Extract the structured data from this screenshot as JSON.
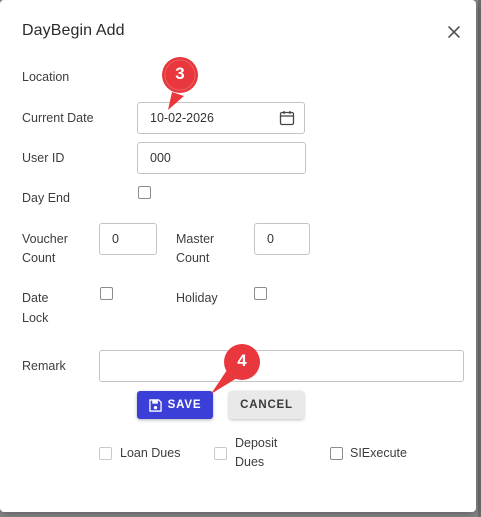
{
  "dialog": {
    "title": "DayBegin Add",
    "close_icon": "close-icon"
  },
  "form": {
    "location_label": "Location",
    "current_date_label": "Current Date",
    "current_date_value": "10-02-2026",
    "calendar_icon": "calendar-icon",
    "user_id_label": "User ID",
    "user_id_value": "000",
    "day_end_label": "Day End",
    "voucher_count_label_1": "Voucher",
    "voucher_count_label_2": "Count",
    "voucher_count_value": "0",
    "master_count_label_1": "Master",
    "master_count_label_2": "Count",
    "master_count_value": "0",
    "date_lock_label_1": "Date",
    "date_lock_label_2": "Lock",
    "holiday_label": "Holiday",
    "remark_label": "Remark",
    "remark_value": ""
  },
  "buttons": {
    "save_label": "SAVE",
    "save_icon": "floppy-disk-icon",
    "cancel_label": "CANCEL"
  },
  "options": {
    "loan_dues_label": "Loan Dues",
    "deposit_dues_label_1": "Deposit",
    "deposit_dues_label_2": "Dues",
    "si_execute_label": "SIExecute"
  },
  "annotations": {
    "marker_3": "3",
    "marker_4": "4",
    "marker_color": "#e8383d"
  },
  "colors": {
    "primary": "#3b3fd8",
    "backdrop": "#8a8a8a"
  }
}
